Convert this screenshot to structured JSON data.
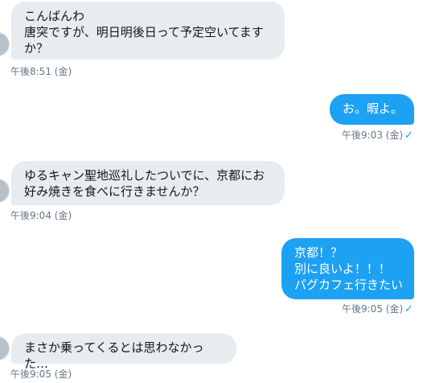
{
  "messages": [
    {
      "direction": "received",
      "text": "こんばんわ\n唐突ですが、明日明後日って予定空いてますか？",
      "time": "午後8:51 (金)"
    },
    {
      "direction": "sent",
      "text": "お。暇よ。",
      "time": "午後9:03 (金)",
      "read_icon": "✓"
    },
    {
      "direction": "received",
      "text": "ゆるキャン聖地巡礼したついでに、京都にお好み焼きを食べに行きませんか？",
      "time": "午後9:04 (金)"
    },
    {
      "direction": "sent",
      "text": "京都！？\n別に良いよ！！！\nパグカフェ行きたい",
      "time": "午後9:05 (金)",
      "read_icon": "✓"
    },
    {
      "direction": "received",
      "text": "まさか乗ってくるとは思わなかった…",
      "time": "午後9:05 (金)"
    }
  ],
  "colors": {
    "sent_bubble": "#1da1f2",
    "received_bubble": "#e6ecf0",
    "timestamp": "#657786",
    "read_check": "#1da1f2"
  },
  "icons": {
    "avatar": "avatar",
    "read_receipt": "checkmark-icon"
  }
}
